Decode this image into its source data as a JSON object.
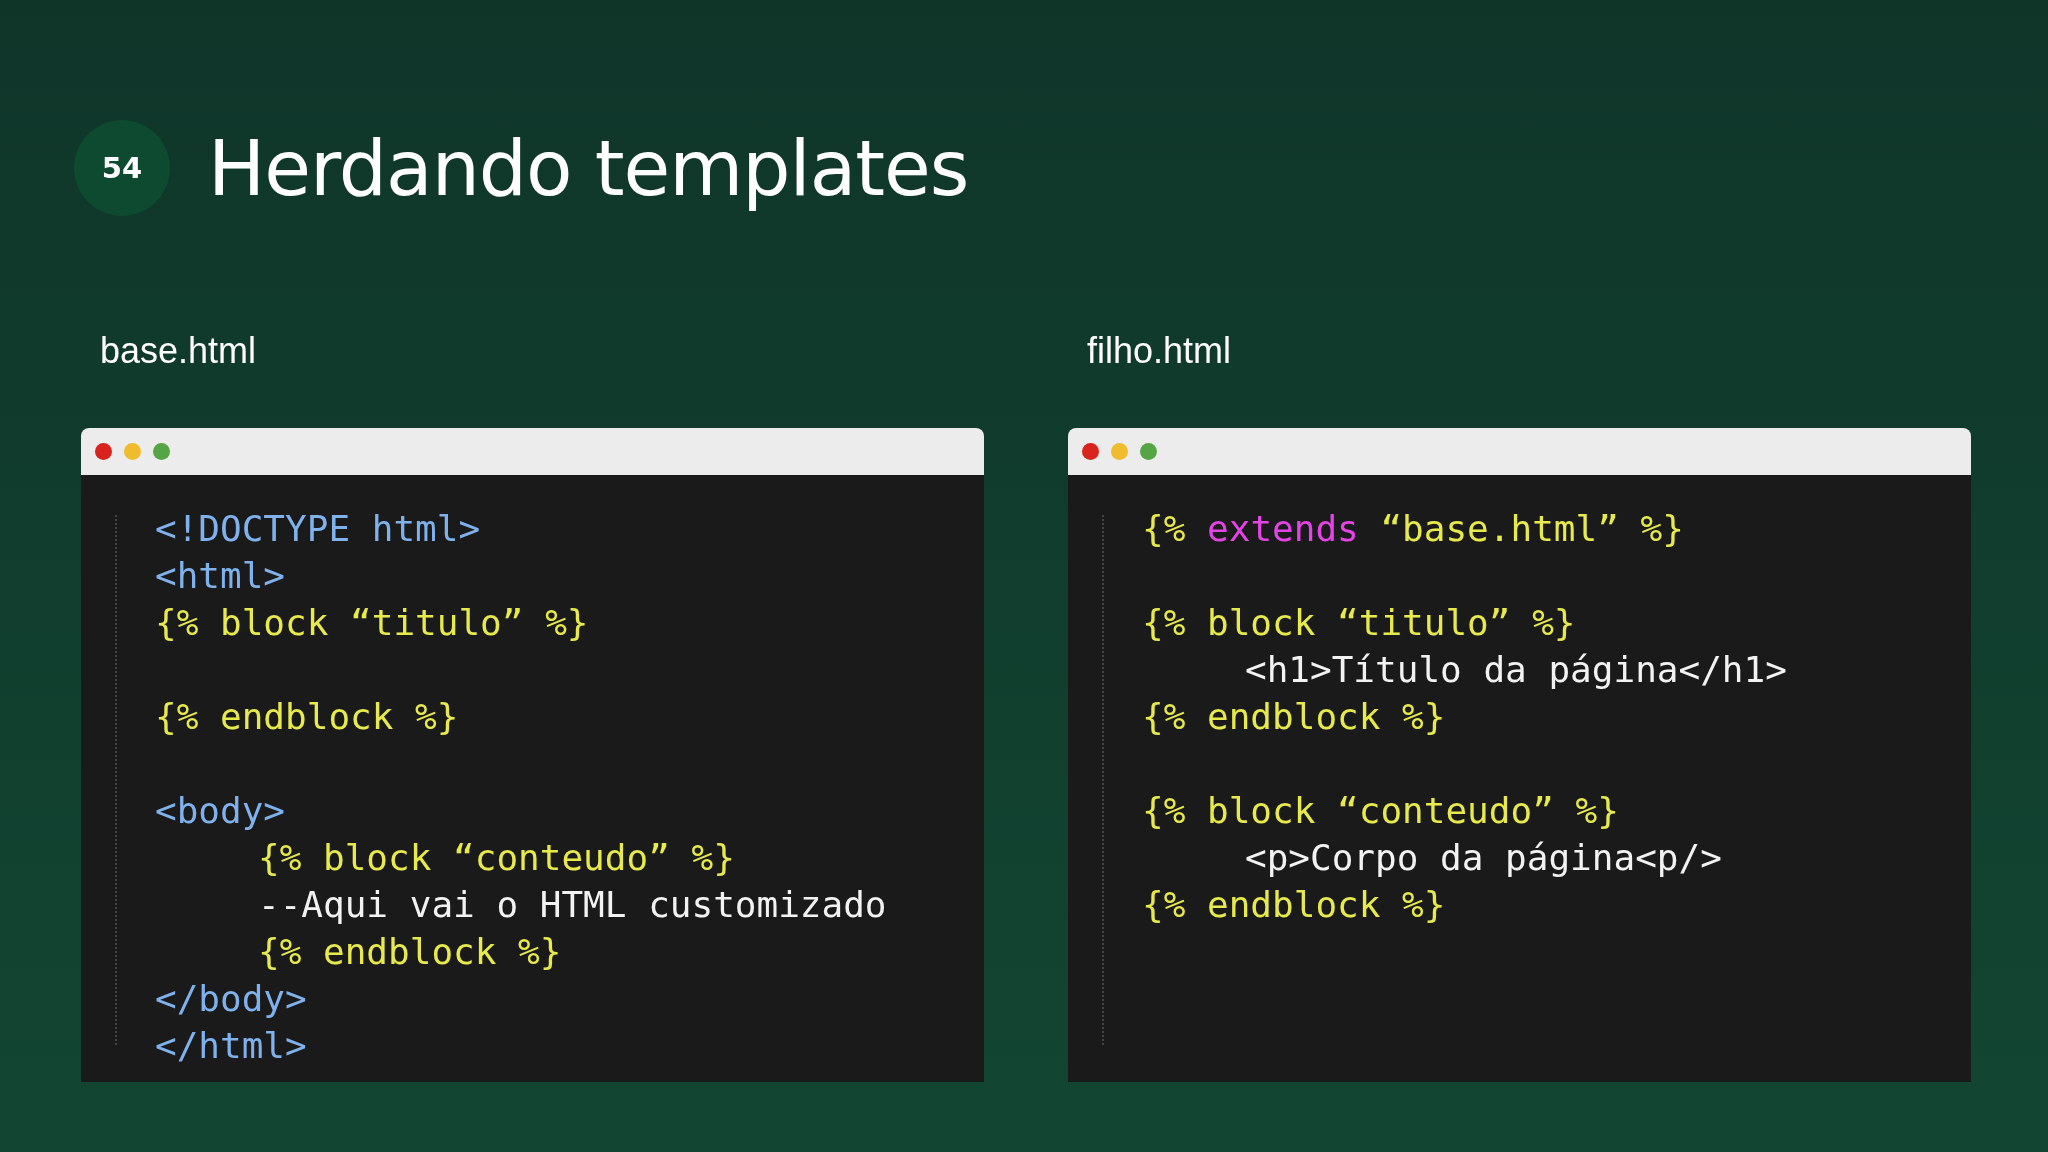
{
  "slide": {
    "number": "54",
    "title": "Herdando templates"
  },
  "panels": [
    {
      "filename": "base.html",
      "lines": [
        {
          "kind": "code",
          "segments": [
            {
              "text": "<!DOCTYPE html>",
              "kind": "tag"
            }
          ]
        },
        {
          "kind": "code",
          "segments": [
            {
              "text": "<html>",
              "kind": "tag"
            }
          ]
        },
        {
          "kind": "code",
          "segments": [
            {
              "text": "{% block “titulo” %}",
              "kind": "template"
            }
          ]
        },
        {
          "kind": "blank"
        },
        {
          "kind": "code",
          "segments": [
            {
              "text": "{% endblock %}",
              "kind": "template"
            }
          ]
        },
        {
          "kind": "blank"
        },
        {
          "kind": "code",
          "segments": [
            {
              "text": "<body>",
              "kind": "tag"
            }
          ]
        },
        {
          "kind": "indented",
          "segments": [
            {
              "text": "{% block “conteudo” %}",
              "kind": "template"
            }
          ]
        },
        {
          "kind": "indented",
          "segments": [
            {
              "text": "--Aqui vai o HTML customizado",
              "kind": "plain"
            }
          ]
        },
        {
          "kind": "indented",
          "segments": [
            {
              "text": "{% endblock %}",
              "kind": "template"
            }
          ]
        },
        {
          "kind": "code",
          "segments": [
            {
              "text": "</body>",
              "kind": "tag"
            }
          ]
        },
        {
          "kind": "code",
          "segments": [
            {
              "text": "</html>",
              "kind": "tag"
            }
          ]
        }
      ]
    },
    {
      "filename": "filho.html",
      "lines": [
        {
          "kind": "code",
          "segments": [
            {
              "text": "{% ",
              "kind": "template"
            },
            {
              "text": "extends",
              "kind": "keyword"
            },
            {
              "text": " “base.html” %}",
              "kind": "template"
            }
          ]
        },
        {
          "kind": "blank"
        },
        {
          "kind": "code",
          "segments": [
            {
              "text": "{% block “titulo” %}",
              "kind": "template"
            }
          ]
        },
        {
          "kind": "indented",
          "segments": [
            {
              "text": "<h1>Título da página</h1>",
              "kind": "plain"
            }
          ]
        },
        {
          "kind": "code",
          "segments": [
            {
              "text": "{% endblock %}",
              "kind": "template"
            }
          ]
        },
        {
          "kind": "blank"
        },
        {
          "kind": "code",
          "segments": [
            {
              "text": "{% block “conteudo” %}",
              "kind": "template"
            }
          ]
        },
        {
          "kind": "indented",
          "segments": [
            {
              "text": "<p>Corpo da página<p/>",
              "kind": "plain"
            }
          ]
        },
        {
          "kind": "code",
          "segments": [
            {
              "text": "{% endblock %}",
              "kind": "template"
            }
          ]
        }
      ]
    }
  ]
}
